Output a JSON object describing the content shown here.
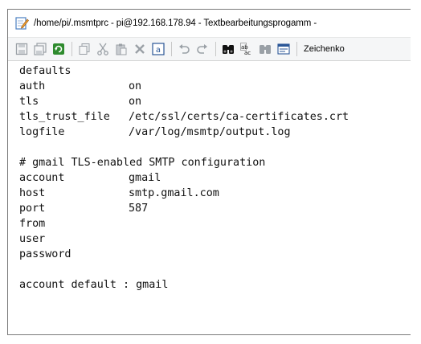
{
  "window": {
    "title": "/home/pi/.msmtprc - pi@192.168.178.94 - Textbearbeitungsprogamm -",
    "title_icon": "edit-document-icon"
  },
  "toolbar": {
    "buttons": [
      {
        "name": "save-icon",
        "color": "#9aa0a6"
      },
      {
        "name": "save-all-icon",
        "color": "#9aa0a6"
      },
      {
        "name": "reload-icon",
        "color": "#2e8b2e"
      },
      {
        "name": "copy-icon",
        "color": "#9aa0a6"
      },
      {
        "name": "cut-icon",
        "color": "#9aa0a6"
      },
      {
        "name": "paste-icon",
        "color": "#9aa0a6"
      },
      {
        "name": "delete-icon",
        "color": "#9aa0a6"
      },
      {
        "name": "select-all-icon",
        "color": "#2b5797"
      },
      {
        "name": "undo-icon",
        "color": "#9aa0a6"
      },
      {
        "name": "redo-icon",
        "color": "#9aa0a6"
      },
      {
        "name": "find-icon",
        "color": "#000000"
      },
      {
        "name": "replace-icon",
        "color": "#000000"
      },
      {
        "name": "find-next-icon",
        "color": "#9aa0a6"
      },
      {
        "name": "go-to-line-icon",
        "color": "#2b5797"
      }
    ],
    "encoding_label": "Zeichenko"
  },
  "editor": {
    "lines": [
      {
        "key": "defaults",
        "value": ""
      },
      {
        "key": "auth",
        "value": "on"
      },
      {
        "key": "tls",
        "value": "on"
      },
      {
        "key": "tls_trust_file",
        "value": "/etc/ssl/certs/ca-certificates.crt"
      },
      {
        "key": "logfile",
        "value": "/var/log/msmtp/output.log"
      },
      {
        "key": "",
        "value": ""
      },
      {
        "key": "# gmail TLS-enabled SMTP configuration",
        "value": ""
      },
      {
        "key": "account",
        "value": "gmail"
      },
      {
        "key": "host",
        "value": "smtp.gmail.com"
      },
      {
        "key": "port",
        "value": "587"
      },
      {
        "key": "from",
        "value": ""
      },
      {
        "key": "user",
        "value": ""
      },
      {
        "key": "password",
        "value": ""
      },
      {
        "key": "",
        "value": ""
      },
      {
        "key": "account default : gmail",
        "value": ""
      }
    ]
  }
}
